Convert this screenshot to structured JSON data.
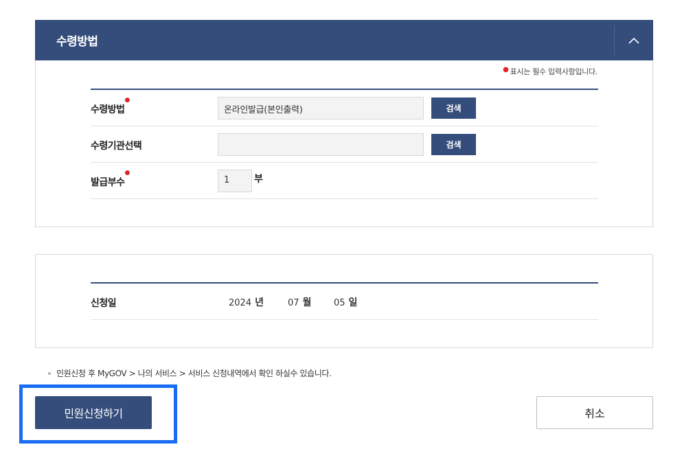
{
  "panel": {
    "title": "수령방법",
    "collapse_icon": "chevron-up-icon"
  },
  "required_note": {
    "marker": "●",
    "text": "표시는 필수 입력사항입니다."
  },
  "form": {
    "receive_method": {
      "label": "수령방법",
      "required": true,
      "value": "온라인발급(본인출력)",
      "button": "검색"
    },
    "receive_org": {
      "label": "수령기관선택",
      "required": false,
      "value": "",
      "button": "검색"
    },
    "copies": {
      "label": "발급부수",
      "required": true,
      "value": "1",
      "unit": "부"
    }
  },
  "apply_date": {
    "label": "신청일",
    "year": "2024",
    "year_unit": "년",
    "month": "07",
    "month_unit": "월",
    "day": "05",
    "day_unit": "일"
  },
  "notice": "민원신청 후 MyGOV > 나의 서비스 > 서비스 신청내역에서 확인 하실수 있습니다.",
  "buttons": {
    "apply": "민원신청하기",
    "cancel": "취소"
  },
  "colors": {
    "primary": "#344d7b",
    "required": "#e0222a",
    "highlight": "#1a6cf2"
  }
}
